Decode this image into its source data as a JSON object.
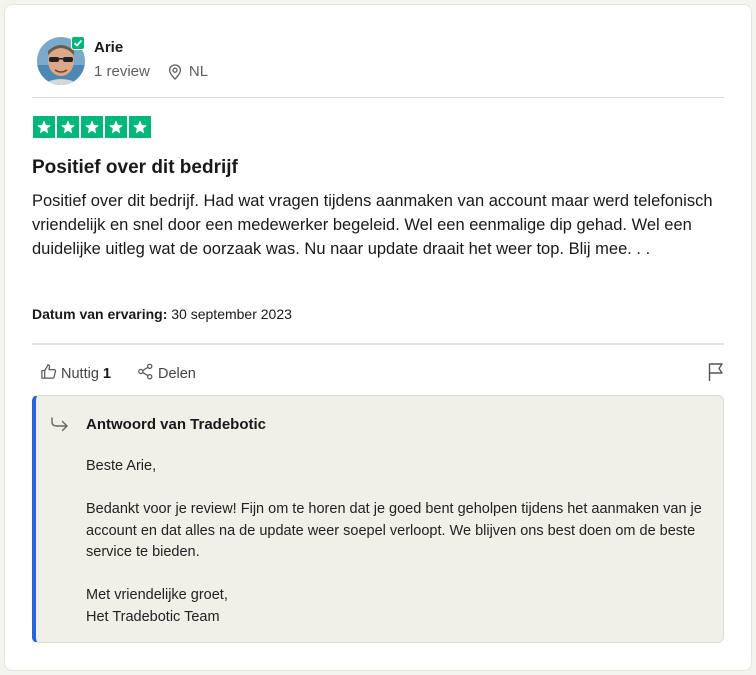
{
  "reviewer": {
    "name": "Arie",
    "review_count": "1 review",
    "country": "NL"
  },
  "rating": {
    "stars": 5,
    "max": 5
  },
  "review": {
    "title": "Positief over dit bedrijf",
    "text": "Positief over dit bedrijf. Had wat vragen tijdens aanmaken van account maar werd telefonisch vriendelijk en snel door een medewerker begeleid. Wel een eenmalige dip gehad. Wel een duidelijke uitleg wat de oorzaak was. Nu naar update draait het weer top. Blij mee. . .",
    "date_label": "Datum van ervaring:",
    "date_value": "30 september 2023"
  },
  "actions": {
    "useful_label": "Nuttig",
    "useful_count": "1",
    "share_label": "Delen"
  },
  "reply": {
    "title": "Antwoord van Tradebotic",
    "greeting": "Beste Arie,",
    "paragraph": "Bedankt voor je review! Fijn om te horen dat je goed bent geholpen tijdens het aanmaken van je account en dat alles na de update weer soepel verloopt. We blijven ons best doen om de beste service te bieden.",
    "closing_1": "Met vriendelijke groet,",
    "closing_2": "Het Tradebotic Team"
  },
  "colors": {
    "star_green": "#00b67a",
    "reply_accent": "#2a63d6",
    "reply_bg": "#f0efe8"
  },
  "icons": [
    "verified-check-icon",
    "location-pin-icon",
    "star-icon",
    "thumbs-up-icon",
    "share-icon",
    "flag-icon",
    "reply-arrow-icon"
  ]
}
